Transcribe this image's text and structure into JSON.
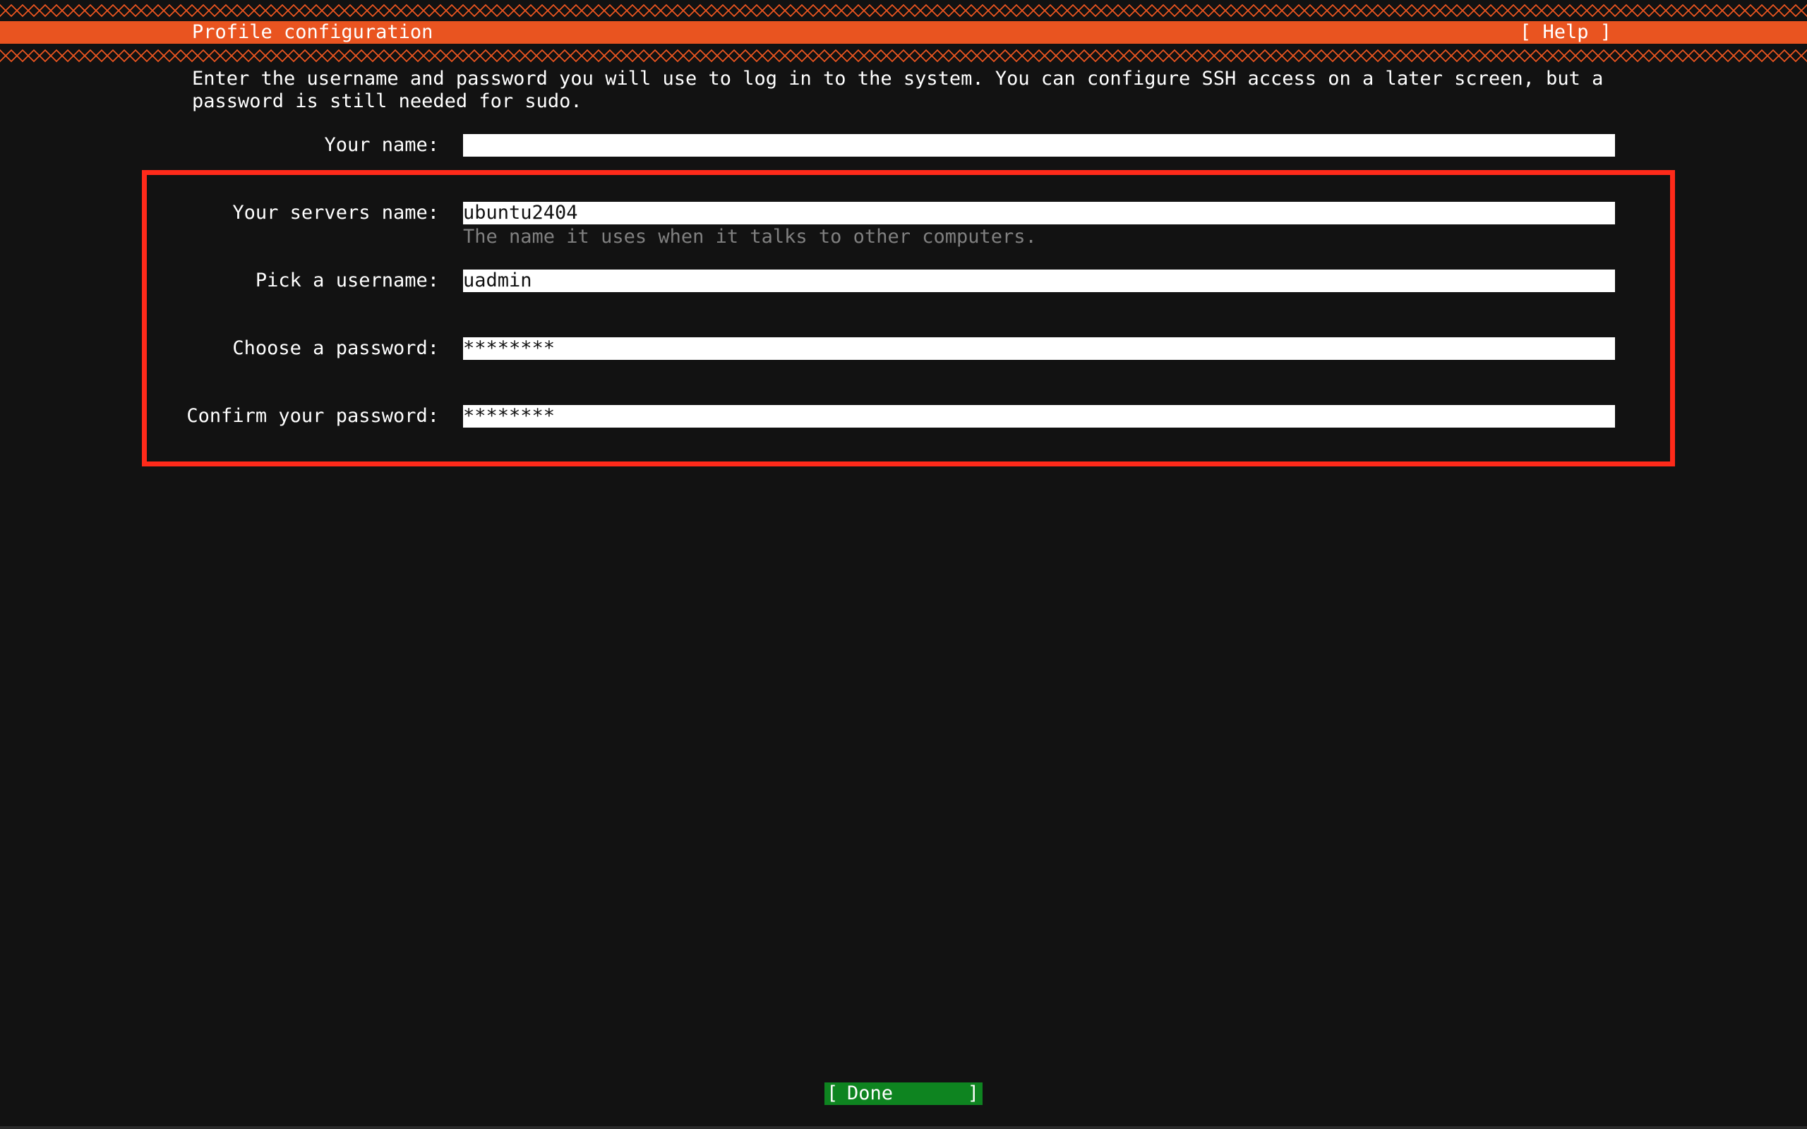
{
  "header": {
    "title": "Profile configuration",
    "help_label": "[ Help ]"
  },
  "intro_text": "Enter the username and password you will use to log in to the system. You can configure SSH access on a later screen, but a password is still needed for sudo.",
  "form": {
    "your_name": {
      "label": "Your name:",
      "value": ""
    },
    "server_name": {
      "label": "Your servers name:",
      "value": "ubuntu2404",
      "hint": "The name it uses when it talks to other computers."
    },
    "username": {
      "label": "Pick a username:",
      "value": "uadmin"
    },
    "password": {
      "label": "Choose a password:",
      "value": "********"
    },
    "confirm_password": {
      "label": "Confirm your password:",
      "value": "********"
    }
  },
  "footer": {
    "done_bracket_left": "[",
    "done_label": "Done",
    "done_bracket_right": "]"
  },
  "colors": {
    "accent": "#e95420",
    "background": "#121212",
    "done_button": "#0e8420",
    "highlight_box": "#ff2a1a",
    "hint_text": "#808080"
  }
}
